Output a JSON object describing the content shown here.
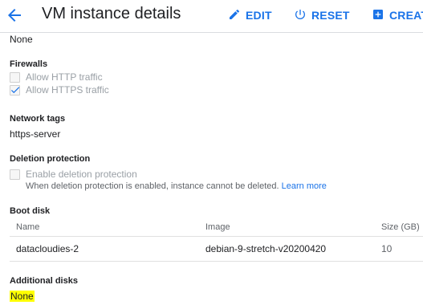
{
  "header": {
    "title": "VM instance details",
    "edit_label": "EDIT",
    "reset_label": "RESET",
    "create_label": "CREATE"
  },
  "network_interface_value": "None",
  "firewalls": {
    "label": "Firewalls",
    "http": {
      "label": "Allow HTTP traffic",
      "checked": false
    },
    "https": {
      "label": "Allow HTTPS traffic",
      "checked": true
    }
  },
  "network_tags": {
    "label": "Network tags",
    "value": "https-server"
  },
  "deletion_protection": {
    "label": "Deletion protection",
    "checkbox_label": "Enable deletion protection",
    "checked": false,
    "helper_text": "When deletion protection is enabled, instance cannot be deleted.",
    "learn_more": "Learn more"
  },
  "boot_disk": {
    "label": "Boot disk",
    "columns": {
      "name": "Name",
      "image": "Image",
      "size": "Size (GB)"
    },
    "rows": [
      {
        "name": "datacloudies-2",
        "image": "debian-9-stretch-v20200420",
        "size": "10"
      }
    ]
  },
  "additional_disks": {
    "label": "Additional disks",
    "value": "None"
  },
  "colors": {
    "accent": "#1a73e8",
    "highlight": "#ffff00",
    "disabled_text": "#9aa0a6"
  },
  "icons": [
    "back-arrow-icon",
    "pencil-icon",
    "power-icon",
    "add-box-icon",
    "checkmark-icon"
  ]
}
